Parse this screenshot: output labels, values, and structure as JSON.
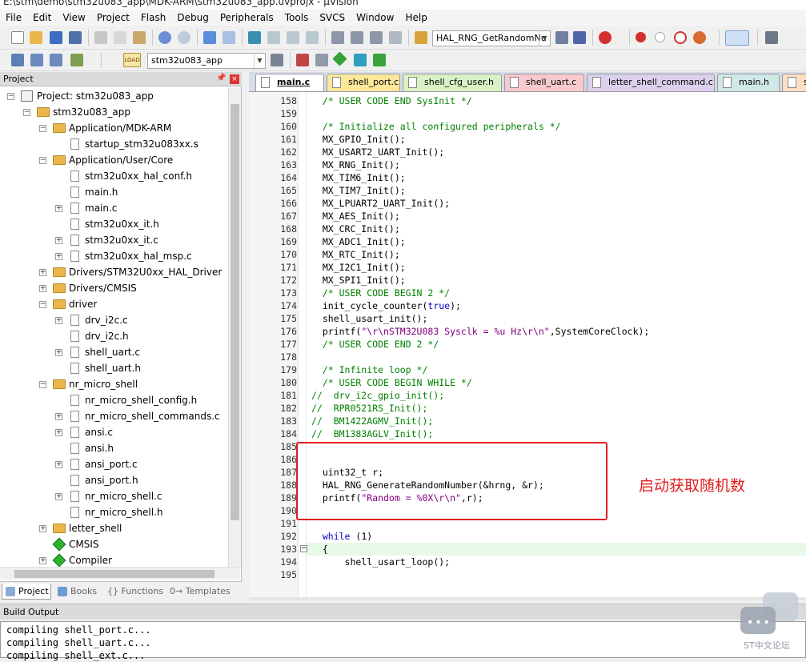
{
  "window": {
    "title": "E:\\stm\\demo\\stm32u083_app\\MDK-ARM\\stm32u083_app.uvprojx - µVision"
  },
  "menu": [
    "File",
    "Edit",
    "View",
    "Project",
    "Flash",
    "Debug",
    "Peripherals",
    "Tools",
    "SVCS",
    "Window",
    "Help"
  ],
  "toolbar": {
    "function_combo": "HAL_RNG_GetRandomNu",
    "target_combo": "stm32u083_app",
    "load_label": "LOAD"
  },
  "project_panel": {
    "title": "Project",
    "tree": [
      {
        "label": "Project: stm32u083_app",
        "level": 0,
        "icon": "project",
        "expander": "−"
      },
      {
        "label": "stm32u083_app",
        "level": 1,
        "icon": "folder",
        "expander": "−"
      },
      {
        "label": "Application/MDK-ARM",
        "level": 2,
        "icon": "folder",
        "expander": "−"
      },
      {
        "label": "startup_stm32u083xx.s",
        "level": 3,
        "icon": "file",
        "expander": ""
      },
      {
        "label": "Application/User/Core",
        "level": 2,
        "icon": "folder",
        "expander": "−"
      },
      {
        "label": "stm32u0xx_hal_conf.h",
        "level": 3,
        "icon": "file",
        "expander": ""
      },
      {
        "label": "main.h",
        "level": 3,
        "icon": "file",
        "expander": ""
      },
      {
        "label": "main.c",
        "level": 3,
        "icon": "file",
        "expander": "+"
      },
      {
        "label": "stm32u0xx_it.h",
        "level": 3,
        "icon": "file",
        "expander": ""
      },
      {
        "label": "stm32u0xx_it.c",
        "level": 3,
        "icon": "file",
        "expander": "+"
      },
      {
        "label": "stm32u0xx_hal_msp.c",
        "level": 3,
        "icon": "file",
        "expander": "+"
      },
      {
        "label": "Drivers/STM32U0xx_HAL_Driver",
        "level": 2,
        "icon": "folder",
        "expander": "+"
      },
      {
        "label": "Drivers/CMSIS",
        "level": 2,
        "icon": "folder",
        "expander": "+"
      },
      {
        "label": "driver",
        "level": 2,
        "icon": "folder",
        "expander": "−"
      },
      {
        "label": "drv_i2c.c",
        "level": 3,
        "icon": "file",
        "expander": "+"
      },
      {
        "label": "drv_i2c.h",
        "level": 3,
        "icon": "file",
        "expander": ""
      },
      {
        "label": "shell_uart.c",
        "level": 3,
        "icon": "file",
        "expander": "+"
      },
      {
        "label": "shell_uart.h",
        "level": 3,
        "icon": "file",
        "expander": ""
      },
      {
        "label": "nr_micro_shell",
        "level": 2,
        "icon": "folder",
        "expander": "−"
      },
      {
        "label": "nr_micro_shell_config.h",
        "level": 3,
        "icon": "file",
        "expander": ""
      },
      {
        "label": "nr_micro_shell_commands.c",
        "level": 3,
        "icon": "file",
        "expander": "+"
      },
      {
        "label": "ansi.c",
        "level": 3,
        "icon": "file",
        "expander": "+"
      },
      {
        "label": "ansi.h",
        "level": 3,
        "icon": "file",
        "expander": ""
      },
      {
        "label": "ansi_port.c",
        "level": 3,
        "icon": "file",
        "expander": "+"
      },
      {
        "label": "ansi_port.h",
        "level": 3,
        "icon": "file",
        "expander": ""
      },
      {
        "label": "nr_micro_shell.c",
        "level": 3,
        "icon": "file",
        "expander": "+"
      },
      {
        "label": "nr_micro_shell.h",
        "level": 3,
        "icon": "file",
        "expander": ""
      },
      {
        "label": "letter_shell",
        "level": 2,
        "icon": "folder",
        "expander": "+"
      },
      {
        "label": "CMSIS",
        "level": 2,
        "icon": "gem",
        "expander": ""
      },
      {
        "label": "Compiler",
        "level": 2,
        "icon": "gem",
        "expander": "+"
      }
    ],
    "tabs": [
      "Project",
      "Books",
      "{} Functions",
      "0→ Templates"
    ]
  },
  "editor_tabs": [
    {
      "label": "main.c",
      "color": "#ffffff"
    },
    {
      "label": "shell_port.c",
      "color": "#fde79a"
    },
    {
      "label": "shell_cfg_user.h",
      "color": "#d9f1c4"
    },
    {
      "label": "shell_uart.c",
      "color": "#f8c9cf"
    },
    {
      "label": "letter_shell_command.c",
      "color": "#dcd0ef"
    },
    {
      "label": "main.h",
      "color": "#cfe9e6"
    },
    {
      "label": "s",
      "color": "#fde0c4"
    }
  ],
  "code": [
    {
      "n": "158",
      "t": "  /* USER CODE END SysInit */",
      "c": "cm"
    },
    {
      "n": "159",
      "t": "",
      "c": ""
    },
    {
      "n": "160",
      "t": "  /* Initialize all configured peripherals */",
      "c": "cm"
    },
    {
      "n": "161",
      "t": "  MX_GPIO_Init();",
      "c": ""
    },
    {
      "n": "162",
      "t": "  MX_USART2_UART_Init();",
      "c": ""
    },
    {
      "n": "163",
      "t": "  MX_RNG_Init();",
      "c": ""
    },
    {
      "n": "164",
      "t": "  MX_TIM6_Init();",
      "c": ""
    },
    {
      "n": "165",
      "t": "  MX_TIM7_Init();",
      "c": ""
    },
    {
      "n": "166",
      "t": "  MX_LPUART2_UART_Init();",
      "c": ""
    },
    {
      "n": "167",
      "t": "  MX_AES_Init();",
      "c": ""
    },
    {
      "n": "168",
      "t": "  MX_CRC_Init();",
      "c": ""
    },
    {
      "n": "169",
      "t": "  MX_ADC1_Init();",
      "c": ""
    },
    {
      "n": "170",
      "t": "  MX_RTC_Init();",
      "c": ""
    },
    {
      "n": "171",
      "t": "  MX_I2C1_Init();",
      "c": ""
    },
    {
      "n": "172",
      "t": "  MX_SPI1_Init();",
      "c": ""
    },
    {
      "n": "173",
      "t": "  /* USER CODE BEGIN 2 */",
      "c": "cm"
    },
    {
      "n": "174",
      "t": "  init_cycle_counter(true);",
      "c": "kwtrue"
    },
    {
      "n": "175",
      "t": "  shell_usart_init();",
      "c": ""
    },
    {
      "n": "176",
      "t": "  printf(\"\\r\\nSTM32U083 Sysclk = %u Hz\\r\\n\",SystemCoreClock);",
      "c": "str"
    },
    {
      "n": "177",
      "t": "  /* USER CODE END 2 */",
      "c": "cm"
    },
    {
      "n": "178",
      "t": "",
      "c": ""
    },
    {
      "n": "179",
      "t": "  /* Infinite loop */",
      "c": "cm"
    },
    {
      "n": "180",
      "t": "  /* USER CODE BEGIN WHILE */",
      "c": "cm"
    },
    {
      "n": "181",
      "t": "//  drv_i2c_gpio_init();",
      "c": "cm"
    },
    {
      "n": "182",
      "t": "//  RPR0521RS_Init();",
      "c": "cm"
    },
    {
      "n": "183",
      "t": "//  BM1422AGMV_Init();",
      "c": "cm"
    },
    {
      "n": "184",
      "t": "//  BM1383AGLV_Init();",
      "c": "cm"
    },
    {
      "n": "185",
      "t": "",
      "c": ""
    },
    {
      "n": "186",
      "t": "",
      "c": ""
    },
    {
      "n": "187",
      "t": "  uint32_t r;",
      "c": ""
    },
    {
      "n": "188",
      "t": "  HAL_RNG_GenerateRandomNumber(&hrng, &r);",
      "c": ""
    },
    {
      "n": "189",
      "t": "  printf(\"Random = %0X\\r\\n\",r);",
      "c": "str2"
    },
    {
      "n": "190",
      "t": "  ",
      "c": ""
    },
    {
      "n": "191",
      "t": "",
      "c": ""
    },
    {
      "n": "192",
      "t": "  while (1)",
      "c": "kwwhile"
    },
    {
      "n": "193",
      "t": "  {",
      "c": "hl"
    },
    {
      "n": "194",
      "t": "      shell_usart_loop();",
      "c": ""
    },
    {
      "n": "195",
      "t": "      ",
      "c": ""
    }
  ],
  "annotation": "启动获取随机数",
  "build_output": {
    "title": "Build Output",
    "lines": [
      "compiling shell_port.c...",
      "compiling shell_uart.c...",
      "compiling shell_ext.c..."
    ]
  },
  "watermark": "ST中文论坛",
  "colors": {
    "annotation_red": "#e31e1e",
    "comment_green": "#008000",
    "keyword_blue": "#0000c8",
    "string_purple": "#800080"
  }
}
